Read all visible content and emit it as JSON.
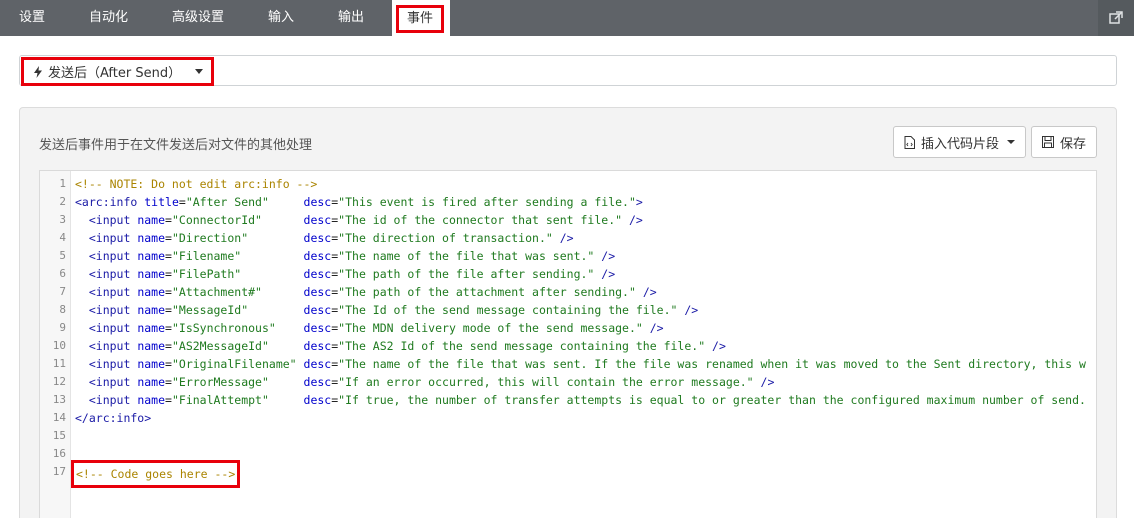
{
  "tabs": [
    {
      "label": "设置",
      "active": false
    },
    {
      "label": "自动化",
      "active": false
    },
    {
      "label": "高级设置",
      "active": false
    },
    {
      "label": "输入",
      "active": false
    },
    {
      "label": "输出",
      "active": false
    },
    {
      "label": "事件",
      "active": true
    }
  ],
  "event": {
    "selected": "发送后（After Send）"
  },
  "panel": {
    "description": "发送后事件用于在文件发送后对文件的其他处理",
    "snippet_label": "插入代码片段",
    "save_label": "保存"
  },
  "editor": {
    "line_numbers": [
      "1",
      "2",
      "3",
      "4",
      "5",
      "6",
      "7",
      "8",
      "9",
      "10",
      "11",
      "12",
      "13",
      "14",
      "15",
      "16",
      "17"
    ],
    "lines": [
      [
        {
          "t": "c",
          "v": "<!-- NOTE: Do not edit arc:info -->"
        }
      ],
      [
        {
          "t": "g",
          "v": "<arc:info "
        },
        {
          "t": "a",
          "v": "title"
        },
        {
          "t": "p",
          "v": "="
        },
        {
          "t": "s",
          "v": "\"After Send\""
        },
        {
          "t": "p",
          "v": "     "
        },
        {
          "t": "a",
          "v": "desc"
        },
        {
          "t": "p",
          "v": "="
        },
        {
          "t": "s",
          "v": "\"This event is fired after sending a file.\""
        },
        {
          "t": "g",
          "v": ">"
        }
      ],
      [
        {
          "t": "p",
          "v": "  "
        },
        {
          "t": "g",
          "v": "<input "
        },
        {
          "t": "a",
          "v": "name"
        },
        {
          "t": "p",
          "v": "="
        },
        {
          "t": "s",
          "v": "\"ConnectorId\""
        },
        {
          "t": "p",
          "v": "      "
        },
        {
          "t": "a",
          "v": "desc"
        },
        {
          "t": "p",
          "v": "="
        },
        {
          "t": "s",
          "v": "\"The id of the connector that sent file.\""
        },
        {
          "t": "g",
          "v": " />"
        }
      ],
      [
        {
          "t": "p",
          "v": "  "
        },
        {
          "t": "g",
          "v": "<input "
        },
        {
          "t": "a",
          "v": "name"
        },
        {
          "t": "p",
          "v": "="
        },
        {
          "t": "s",
          "v": "\"Direction\""
        },
        {
          "t": "p",
          "v": "        "
        },
        {
          "t": "a",
          "v": "desc"
        },
        {
          "t": "p",
          "v": "="
        },
        {
          "t": "s",
          "v": "\"The direction of transaction.\""
        },
        {
          "t": "g",
          "v": " />"
        }
      ],
      [
        {
          "t": "p",
          "v": "  "
        },
        {
          "t": "g",
          "v": "<input "
        },
        {
          "t": "a",
          "v": "name"
        },
        {
          "t": "p",
          "v": "="
        },
        {
          "t": "s",
          "v": "\"Filename\""
        },
        {
          "t": "p",
          "v": "         "
        },
        {
          "t": "a",
          "v": "desc"
        },
        {
          "t": "p",
          "v": "="
        },
        {
          "t": "s",
          "v": "\"The name of the file that was sent.\""
        },
        {
          "t": "g",
          "v": " />"
        }
      ],
      [
        {
          "t": "p",
          "v": "  "
        },
        {
          "t": "g",
          "v": "<input "
        },
        {
          "t": "a",
          "v": "name"
        },
        {
          "t": "p",
          "v": "="
        },
        {
          "t": "s",
          "v": "\"FilePath\""
        },
        {
          "t": "p",
          "v": "         "
        },
        {
          "t": "a",
          "v": "desc"
        },
        {
          "t": "p",
          "v": "="
        },
        {
          "t": "s",
          "v": "\"The path of the file after sending.\""
        },
        {
          "t": "g",
          "v": " />"
        }
      ],
      [
        {
          "t": "p",
          "v": "  "
        },
        {
          "t": "g",
          "v": "<input "
        },
        {
          "t": "a",
          "v": "name"
        },
        {
          "t": "p",
          "v": "="
        },
        {
          "t": "s",
          "v": "\"Attachment#\""
        },
        {
          "t": "p",
          "v": "      "
        },
        {
          "t": "a",
          "v": "desc"
        },
        {
          "t": "p",
          "v": "="
        },
        {
          "t": "s",
          "v": "\"The path of the attachment after sending.\""
        },
        {
          "t": "g",
          "v": " />"
        }
      ],
      [
        {
          "t": "p",
          "v": "  "
        },
        {
          "t": "g",
          "v": "<input "
        },
        {
          "t": "a",
          "v": "name"
        },
        {
          "t": "p",
          "v": "="
        },
        {
          "t": "s",
          "v": "\"MessageId\""
        },
        {
          "t": "p",
          "v": "        "
        },
        {
          "t": "a",
          "v": "desc"
        },
        {
          "t": "p",
          "v": "="
        },
        {
          "t": "s",
          "v": "\"The Id of the send message containing the file.\""
        },
        {
          "t": "g",
          "v": " />"
        }
      ],
      [
        {
          "t": "p",
          "v": "  "
        },
        {
          "t": "g",
          "v": "<input "
        },
        {
          "t": "a",
          "v": "name"
        },
        {
          "t": "p",
          "v": "="
        },
        {
          "t": "s",
          "v": "\"IsSynchronous\""
        },
        {
          "t": "p",
          "v": "    "
        },
        {
          "t": "a",
          "v": "desc"
        },
        {
          "t": "p",
          "v": "="
        },
        {
          "t": "s",
          "v": "\"The MDN delivery mode of the send message.\""
        },
        {
          "t": "g",
          "v": " />"
        }
      ],
      [
        {
          "t": "p",
          "v": "  "
        },
        {
          "t": "g",
          "v": "<input "
        },
        {
          "t": "a",
          "v": "name"
        },
        {
          "t": "p",
          "v": "="
        },
        {
          "t": "s",
          "v": "\"AS2MessageId\""
        },
        {
          "t": "p",
          "v": "     "
        },
        {
          "t": "a",
          "v": "desc"
        },
        {
          "t": "p",
          "v": "="
        },
        {
          "t": "s",
          "v": "\"The AS2 Id of the send message containing the file.\""
        },
        {
          "t": "g",
          "v": " />"
        }
      ],
      [
        {
          "t": "p",
          "v": "  "
        },
        {
          "t": "g",
          "v": "<input "
        },
        {
          "t": "a",
          "v": "name"
        },
        {
          "t": "p",
          "v": "="
        },
        {
          "t": "s",
          "v": "\"OriginalFilename\""
        },
        {
          "t": "p",
          "v": " "
        },
        {
          "t": "a",
          "v": "desc"
        },
        {
          "t": "p",
          "v": "="
        },
        {
          "t": "s",
          "v": "\"The name of the file that was sent. If the file was renamed when it was moved to the Sent directory, this w"
        }
      ],
      [
        {
          "t": "p",
          "v": "  "
        },
        {
          "t": "g",
          "v": "<input "
        },
        {
          "t": "a",
          "v": "name"
        },
        {
          "t": "p",
          "v": "="
        },
        {
          "t": "s",
          "v": "\"ErrorMessage\""
        },
        {
          "t": "p",
          "v": "     "
        },
        {
          "t": "a",
          "v": "desc"
        },
        {
          "t": "p",
          "v": "="
        },
        {
          "t": "s",
          "v": "\"If an error occurred, this will contain the error message.\""
        },
        {
          "t": "g",
          "v": " />"
        }
      ],
      [
        {
          "t": "p",
          "v": "  "
        },
        {
          "t": "g",
          "v": "<input "
        },
        {
          "t": "a",
          "v": "name"
        },
        {
          "t": "p",
          "v": "="
        },
        {
          "t": "s",
          "v": "\"FinalAttempt\""
        },
        {
          "t": "p",
          "v": "     "
        },
        {
          "t": "a",
          "v": "desc"
        },
        {
          "t": "p",
          "v": "="
        },
        {
          "t": "s",
          "v": "\"If true, the number of transfer attempts is equal to or greater than the configured maximum number of send."
        }
      ],
      [
        {
          "t": "g",
          "v": "</arc:info>"
        }
      ],
      [],
      [],
      [
        {
          "t": "h",
          "v": "<!-- Code goes here -->"
        }
      ]
    ]
  },
  "colors": {
    "tabbar_bg": "#5f6368",
    "highlight_red": "#e8000b",
    "comment": "#aa8400",
    "string": "#1f7a1f",
    "tag": "#1a1aa6"
  }
}
